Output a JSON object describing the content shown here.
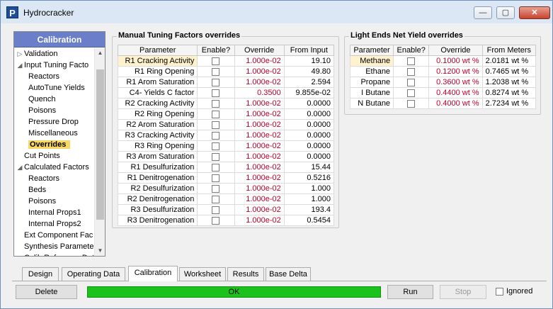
{
  "window": {
    "title": "Hydrocracker",
    "app_icon": "P",
    "minimize_glyph": "—",
    "maximize_glyph": "▢",
    "close_glyph": "✕"
  },
  "nav": {
    "header": "Calibration",
    "items": [
      {
        "label": "Validation",
        "indent": 0,
        "arrow": "▷",
        "selected": false
      },
      {
        "label": "Input Tuning Facto",
        "indent": 0,
        "arrow": "◢",
        "selected": false
      },
      {
        "label": "Reactors",
        "indent": 1,
        "arrow": "",
        "selected": false
      },
      {
        "label": "AutoTune Yields",
        "indent": 1,
        "arrow": "",
        "selected": false
      },
      {
        "label": "Quench",
        "indent": 1,
        "arrow": "",
        "selected": false
      },
      {
        "label": "Poisons",
        "indent": 1,
        "arrow": "",
        "selected": false
      },
      {
        "label": "Pressure Drop",
        "indent": 1,
        "arrow": "",
        "selected": false
      },
      {
        "label": "Miscellaneous",
        "indent": 1,
        "arrow": "",
        "selected": false
      },
      {
        "label": "Overrides",
        "indent": 1,
        "arrow": "",
        "selected": true
      },
      {
        "label": "Cut Points",
        "indent": 0,
        "arrow": "",
        "selected": false
      },
      {
        "label": "Calculated Factors",
        "indent": 0,
        "arrow": "◢",
        "selected": false
      },
      {
        "label": "Reactors",
        "indent": 1,
        "arrow": "",
        "selected": false
      },
      {
        "label": "Beds",
        "indent": 1,
        "arrow": "",
        "selected": false
      },
      {
        "label": "Poisons",
        "indent": 1,
        "arrow": "",
        "selected": false
      },
      {
        "label": "Internal Props1",
        "indent": 1,
        "arrow": "",
        "selected": false
      },
      {
        "label": "Internal Props2",
        "indent": 1,
        "arrow": "",
        "selected": false
      },
      {
        "label": "Ext Component Fac",
        "indent": 0,
        "arrow": "",
        "selected": false
      },
      {
        "label": "Synthesis Paramete",
        "indent": 0,
        "arrow": "",
        "selected": false
      },
      {
        "label": "Calib Reference Dat",
        "indent": 0,
        "arrow": "",
        "selected": false
      }
    ],
    "scroll_up": "▲",
    "scroll_down": "▼"
  },
  "manual": {
    "title": "Manual Tuning Factors overrides",
    "headers": [
      "Parameter",
      "Enable?",
      "Override",
      "From Input"
    ],
    "rows": [
      {
        "param": "R1 Cracking Activity",
        "override": "1.000e-02",
        "input": "19.10",
        "highlight": true
      },
      {
        "param": "R1 Ring Opening",
        "override": "1.000e-02",
        "input": "49.80"
      },
      {
        "param": "R1 Arom Saturation",
        "override": "1.000e-02",
        "input": "2.594"
      },
      {
        "param": "C4- Yields C factor",
        "override": "0.3500",
        "input": "9.855e-02"
      },
      {
        "param": "R2 Cracking Activity",
        "override": "1.000e-02",
        "input": "0.0000"
      },
      {
        "param": "R2 Ring Opening",
        "override": "1.000e-02",
        "input": "0.0000"
      },
      {
        "param": "R2 Arom Saturation",
        "override": "1.000e-02",
        "input": "0.0000"
      },
      {
        "param": "R3 Cracking Activity",
        "override": "1.000e-02",
        "input": "0.0000"
      },
      {
        "param": "R3 Ring Opening",
        "override": "1.000e-02",
        "input": "0.0000"
      },
      {
        "param": "R3 Arom Saturation",
        "override": "1.000e-02",
        "input": "0.0000"
      },
      {
        "param": "R1 Desulfurization",
        "override": "1.000e-02",
        "input": "15.44"
      },
      {
        "param": "R1 Denitrogenation",
        "override": "1.000e-02",
        "input": "0.5216"
      },
      {
        "param": "R2 Desulfurization",
        "override": "1.000e-02",
        "input": "1.000"
      },
      {
        "param": "R2 Denitrogenation",
        "override": "1.000e-02",
        "input": "1.000"
      },
      {
        "param": "R3 Desulfurization",
        "override": "1.000e-02",
        "input": "193.4"
      },
      {
        "param": "R3 Denitrogenation",
        "override": "1.000e-02",
        "input": "0.5454"
      }
    ]
  },
  "light": {
    "title": "Light Ends Net Yield overrides",
    "headers": [
      "Parameter",
      "Enable?",
      "Override",
      "From Meters"
    ],
    "rows": [
      {
        "param": "Methane",
        "override": "0.1000 wt %",
        "meters": "2.0181 wt %",
        "highlight": true
      },
      {
        "param": "Ethane",
        "override": "0.1200 wt %",
        "meters": "0.7465 wt %"
      },
      {
        "param": "Propane",
        "override": "0.3600 wt %",
        "meters": "1.2038 wt %"
      },
      {
        "param": "I Butane",
        "override": "0.4400 wt %",
        "meters": "0.8274 wt %"
      },
      {
        "param": "N Butane",
        "override": "0.4000 wt %",
        "meters": "2.7234 wt %"
      }
    ]
  },
  "tabs": [
    "Design",
    "Operating Data",
    "Calibration",
    "Worksheet",
    "Results",
    "Base Delta"
  ],
  "active_tab": "Calibration",
  "buttons": {
    "delete": "Delete",
    "run": "Run",
    "stop": "Stop"
  },
  "status": {
    "text": "OK",
    "color": "#1bc21b"
  },
  "ignored": {
    "label": "Ignored",
    "checked": false
  },
  "colors": {
    "override_text": "#c0002a",
    "nav_header": "#6a7fc8",
    "selected_item": "#f8d860"
  }
}
